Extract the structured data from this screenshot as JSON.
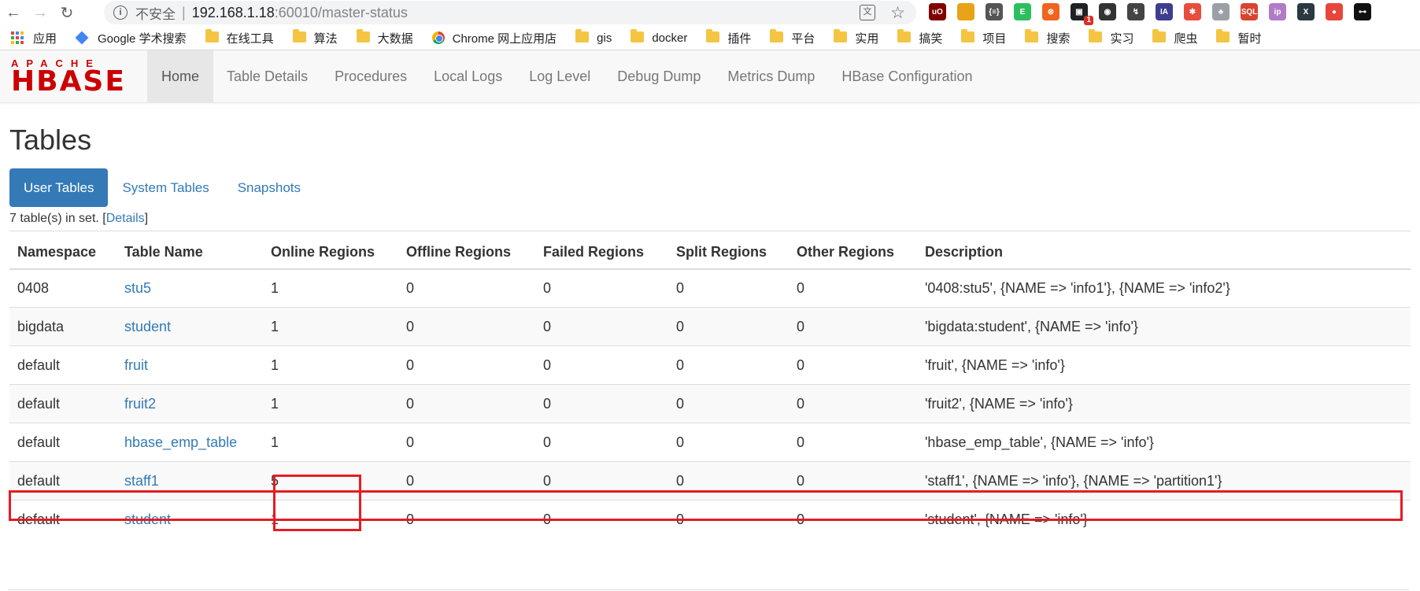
{
  "browser": {
    "insecure_label": "不安全",
    "url_host": "192.168.1.18",
    "url_rest": ":60010/master-status",
    "translate_icon": "文",
    "extensions": [
      {
        "name": "ublock",
        "label": "uO",
        "color": "#800000"
      },
      {
        "name": "chrome-ring",
        "label": "",
        "color": "#e8a317"
      },
      {
        "name": "json",
        "label": "{≡}",
        "color": "#555555"
      },
      {
        "name": "evernote",
        "label": "E",
        "color": "#2dbe60"
      },
      {
        "name": "orange-ext",
        "label": "⊗",
        "color": "#f0641e"
      },
      {
        "name": "badge-ext",
        "label": "▣",
        "color": "#202124",
        "badge": "1"
      },
      {
        "name": "mask-ext",
        "label": "◉",
        "color": "#333333"
      },
      {
        "name": "proxy-ext",
        "label": "↯",
        "color": "#444444"
      },
      {
        "name": "ia-ext",
        "label": "IA",
        "color": "#3f3d8f"
      },
      {
        "name": "colorful-ext",
        "label": "✱",
        "color": "#e84c3d"
      },
      {
        "name": "tree-ext",
        "label": "♣",
        "color": "#9aa0a6"
      },
      {
        "name": "sql-ext",
        "label": "SQL",
        "color": "#d9432f"
      },
      {
        "name": "purple-ext",
        "label": "ip",
        "color": "#b07cc6"
      },
      {
        "name": "x-ext",
        "label": "X",
        "color": "#2b3a42"
      },
      {
        "name": "pin-ext",
        "label": "●",
        "color": "#e8453c"
      },
      {
        "name": "key-ext",
        "label": "⊶",
        "color": "#111111"
      }
    ]
  },
  "bookmarks": [
    {
      "label": "应用",
      "icon": "apps"
    },
    {
      "label": "Google 学术搜索",
      "icon": "scholar"
    },
    {
      "label": "在线工具",
      "icon": "folder"
    },
    {
      "label": "算法",
      "icon": "folder"
    },
    {
      "label": "大数据",
      "icon": "folder"
    },
    {
      "label": "Chrome 网上应用店",
      "icon": "chrome"
    },
    {
      "label": "gis",
      "icon": "folder"
    },
    {
      "label": "docker",
      "icon": "folder"
    },
    {
      "label": "插件",
      "icon": "folder"
    },
    {
      "label": "平台",
      "icon": "folder"
    },
    {
      "label": "实用",
      "icon": "folder"
    },
    {
      "label": "搞笑",
      "icon": "folder"
    },
    {
      "label": "项目",
      "icon": "folder"
    },
    {
      "label": "搜索",
      "icon": "folder"
    },
    {
      "label": "实习",
      "icon": "folder"
    },
    {
      "label": "爬虫",
      "icon": "folder"
    },
    {
      "label": "暂时",
      "icon": "folder"
    }
  ],
  "navbar": {
    "logo_top": "APACHE",
    "logo_main": "HBASE",
    "items": [
      "Home",
      "Table Details",
      "Procedures",
      "Local Logs",
      "Log Level",
      "Debug Dump",
      "Metrics Dump",
      "HBase Configuration"
    ],
    "active_index": 0
  },
  "page": {
    "title": "Tables",
    "tabs": [
      "User Tables",
      "System Tables",
      "Snapshots"
    ],
    "active_tab": 0,
    "count_prefix": "7 table(s) in set. [",
    "count_link": "Details",
    "count_suffix": "]"
  },
  "table": {
    "columns": [
      "Namespace",
      "Table Name",
      "Online Regions",
      "Offline Regions",
      "Failed Regions",
      "Split Regions",
      "Other Regions",
      "Description"
    ],
    "rows": [
      [
        "0408",
        "stu5",
        "1",
        "0",
        "0",
        "0",
        "0",
        "'0408:stu5', {NAME => 'info1'}, {NAME => 'info2'}"
      ],
      [
        "bigdata",
        "student",
        "1",
        "0",
        "0",
        "0",
        "0",
        "'bigdata:student', {NAME => 'info'}"
      ],
      [
        "default",
        "fruit",
        "1",
        "0",
        "0",
        "0",
        "0",
        "'fruit', {NAME => 'info'}"
      ],
      [
        "default",
        "fruit2",
        "1",
        "0",
        "0",
        "0",
        "0",
        "'fruit2', {NAME => 'info'}"
      ],
      [
        "default",
        "hbase_emp_table",
        "1",
        "0",
        "0",
        "0",
        "0",
        "'hbase_emp_table', {NAME => 'info'}"
      ],
      [
        "default",
        "staff1",
        "5",
        "0",
        "0",
        "0",
        "0",
        "'staff1', {NAME => 'info'}, {NAME => 'partition1'}"
      ],
      [
        "default",
        "student",
        "1",
        "0",
        "0",
        "0",
        "0",
        "'student', {NAME => 'info'}"
      ]
    ]
  },
  "annotation_color": "#e51c23"
}
